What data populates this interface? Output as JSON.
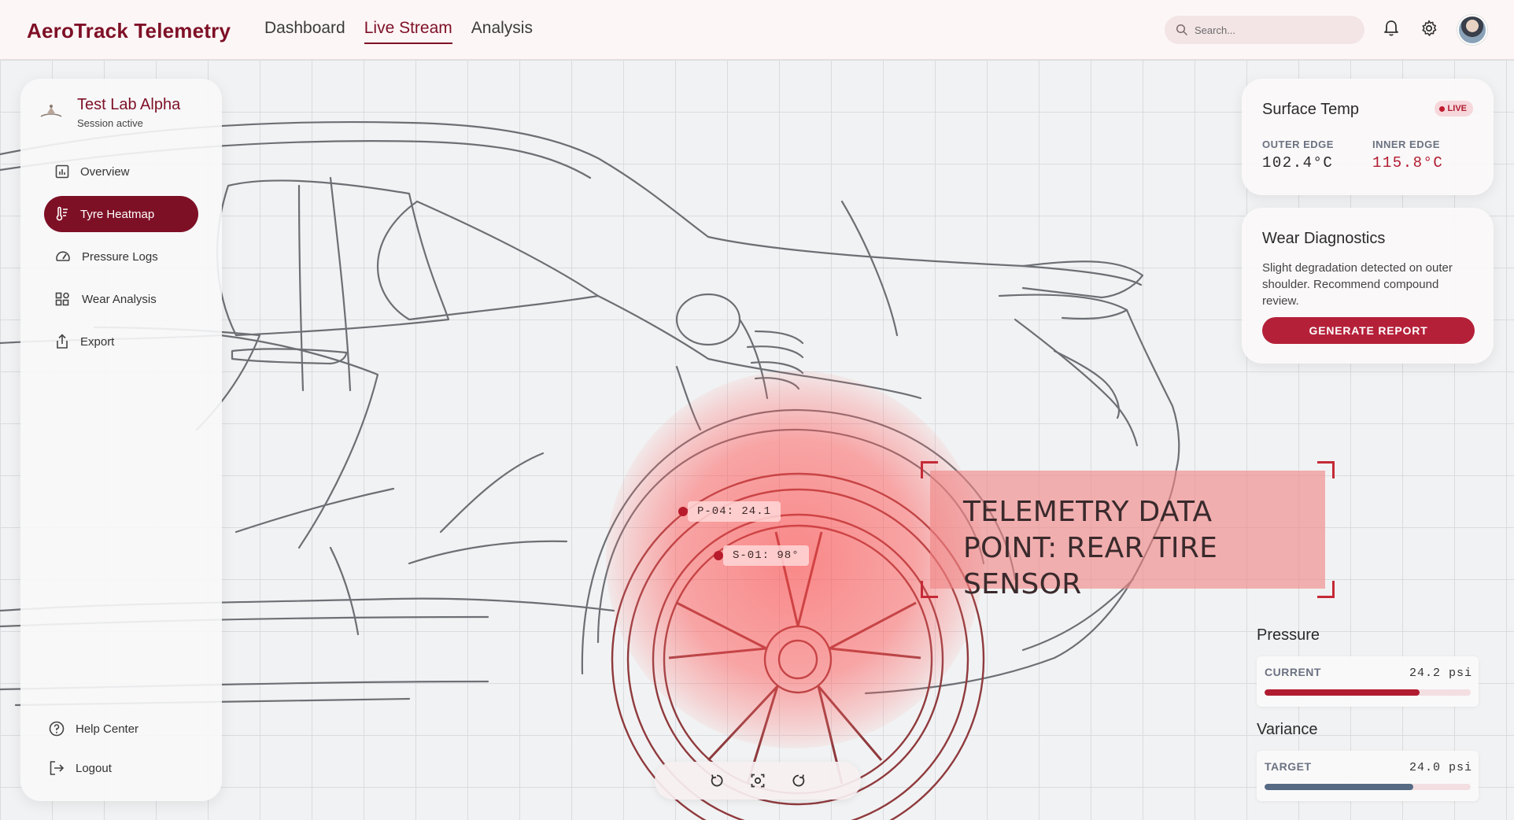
{
  "header": {
    "brand": "AeroTrack Telemetry",
    "tabs": [
      {
        "label": "Dashboard",
        "active": false
      },
      {
        "label": "Live Stream",
        "active": true
      },
      {
        "label": "Analysis",
        "active": false
      }
    ],
    "search_placeholder": "Search...",
    "icons": [
      "bell-icon",
      "gear-icon"
    ],
    "accent_color": "#7e1026"
  },
  "sidebar": {
    "lab_name": "Test Lab Alpha",
    "session_status": "Session active",
    "items": [
      {
        "label": "Overview",
        "icon": "bar-chart-icon",
        "active": false
      },
      {
        "label": "Tyre Heatmap",
        "icon": "thermometer-icon",
        "active": true
      },
      {
        "label": "Pressure Logs",
        "icon": "gauge-icon",
        "active": false
      },
      {
        "label": "Wear Analysis",
        "icon": "analysis-icon",
        "active": false
      },
      {
        "label": "Export",
        "icon": "share-icon",
        "active": false
      }
    ],
    "footer": [
      {
        "label": "Help Center",
        "icon": "help-icon"
      },
      {
        "label": "Logout",
        "icon": "logout-icon"
      }
    ]
  },
  "viewer": {
    "callout": "TELEMETRY DATA POINT: REAR TIRE SENSOR",
    "sensors": [
      {
        "label": "P-04: 24.1"
      },
      {
        "label": "S-01: 98°"
      }
    ],
    "controls": [
      "rotate-left-icon",
      "focus-icon",
      "rotate-right-icon"
    ],
    "heat_color": "#ff4646"
  },
  "surface_temp": {
    "title": "Surface Temp",
    "badge": "LIVE",
    "outer_label": "OUTER EDGE",
    "outer_value": "102.4°C",
    "inner_label": "INNER EDGE",
    "inner_value": "115.8°C",
    "inner_color": "#b01c30"
  },
  "wear": {
    "title": "Wear Diagnostics",
    "text": "Slight degradation detected on outer shoulder. Recommend compound review.",
    "button": "GENERATE REPORT"
  },
  "pressure": {
    "title": "Pressure",
    "label": "CURRENT",
    "value": "24.2 psi",
    "fill_fraction": 0.75,
    "color": "#b01c30"
  },
  "variance": {
    "title": "Variance",
    "label": "TARGET",
    "value": "24.0 psi",
    "fill_fraction": 0.72,
    "color": "#566a84"
  }
}
